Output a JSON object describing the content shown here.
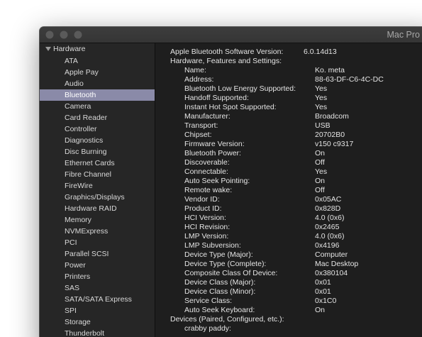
{
  "window": {
    "title": "Mac Pro"
  },
  "sidebar": {
    "header": "Hardware",
    "items": [
      {
        "label": "ATA"
      },
      {
        "label": "Apple Pay"
      },
      {
        "label": "Audio"
      },
      {
        "label": "Bluetooth",
        "selected": true
      },
      {
        "label": "Camera"
      },
      {
        "label": "Card Reader"
      },
      {
        "label": "Controller"
      },
      {
        "label": "Diagnostics"
      },
      {
        "label": "Disc Burning"
      },
      {
        "label": "Ethernet Cards"
      },
      {
        "label": "Fibre Channel"
      },
      {
        "label": "FireWire"
      },
      {
        "label": "Graphics/Displays"
      },
      {
        "label": "Hardware RAID"
      },
      {
        "label": "Memory"
      },
      {
        "label": "NVMExpress"
      },
      {
        "label": "PCI"
      },
      {
        "label": "Parallel SCSI"
      },
      {
        "label": "Power"
      },
      {
        "label": "Printers"
      },
      {
        "label": "SAS"
      },
      {
        "label": "SATA/SATA Express"
      },
      {
        "label": "SPI"
      },
      {
        "label": "Storage"
      },
      {
        "label": "Thunderbolt"
      }
    ]
  },
  "content": {
    "software_version_label": "Apple Bluetooth Software Version:",
    "software_version_value": "6.0.14d13",
    "hw_section_label": "Hardware, Features and Settings:",
    "properties": [
      {
        "key": "Name:",
        "value": "Ko. meta"
      },
      {
        "key": "Address:",
        "value": "88-63-DF-C6-4C-DC"
      },
      {
        "key": "Bluetooth Low Energy Supported:",
        "value": "Yes"
      },
      {
        "key": "Handoff Supported:",
        "value": "Yes"
      },
      {
        "key": "Instant Hot Spot Supported:",
        "value": "Yes"
      },
      {
        "key": "Manufacturer:",
        "value": "Broadcom"
      },
      {
        "key": "Transport:",
        "value": "USB"
      },
      {
        "key": "Chipset:",
        "value": "20702B0"
      },
      {
        "key": "Firmware Version:",
        "value": "v150 c9317"
      },
      {
        "key": "Bluetooth Power:",
        "value": "On"
      },
      {
        "key": "Discoverable:",
        "value": "Off"
      },
      {
        "key": "Connectable:",
        "value": "Yes"
      },
      {
        "key": "Auto Seek Pointing:",
        "value": "On"
      },
      {
        "key": "Remote wake:",
        "value": "Off"
      },
      {
        "key": "Vendor ID:",
        "value": "0x05AC"
      },
      {
        "key": "Product ID:",
        "value": "0x828D"
      },
      {
        "key": "HCI Version:",
        "value": "4.0 (0x6)"
      },
      {
        "key": "HCI Revision:",
        "value": "0x2465"
      },
      {
        "key": "LMP Version:",
        "value": "4.0 (0x6)"
      },
      {
        "key": "LMP Subversion:",
        "value": "0x4196"
      },
      {
        "key": "Device Type (Major):",
        "value": "Computer"
      },
      {
        "key": "Device Type (Complete):",
        "value": "Mac Desktop"
      },
      {
        "key": "Composite Class Of Device:",
        "value": "0x380104"
      },
      {
        "key": "Device Class (Major):",
        "value": "0x01"
      },
      {
        "key": "Device Class (Minor):",
        "value": "0x01"
      },
      {
        "key": "Service Class:",
        "value": "0x1C0"
      },
      {
        "key": "Auto Seek Keyboard:",
        "value": "On"
      }
    ],
    "devices_label": "Devices (Paired, Configured, etc.):",
    "device_name": "crabby paddy:"
  }
}
